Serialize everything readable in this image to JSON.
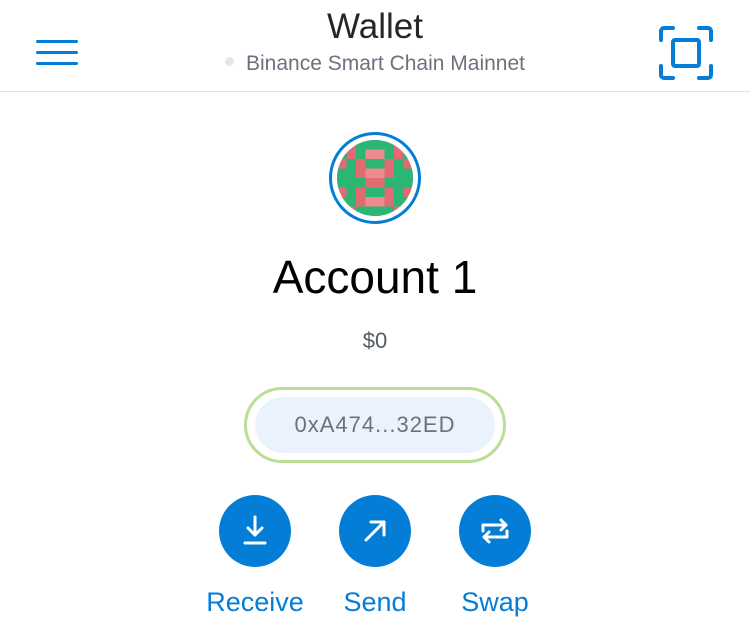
{
  "header": {
    "title": "Wallet",
    "network": "Binance Smart Chain Mainnet",
    "menu_icon": "hamburger-menu-icon",
    "scan_icon": "qr-scan-icon"
  },
  "account": {
    "name": "Account 1",
    "balance": "$0",
    "address": "0xA474...32ED"
  },
  "actions": [
    {
      "label": "Receive",
      "icon": "download-icon"
    },
    {
      "label": "Send",
      "icon": "arrow-up-right-icon"
    },
    {
      "label": "Swap",
      "icon": "swap-arrows-icon"
    }
  ],
  "colors": {
    "accent": "#037dd6",
    "address_outline": "#b9de94",
    "address_bg": "#eaf3fd",
    "avatar_green": "#2bb673",
    "avatar_pink": "#e06b72"
  }
}
